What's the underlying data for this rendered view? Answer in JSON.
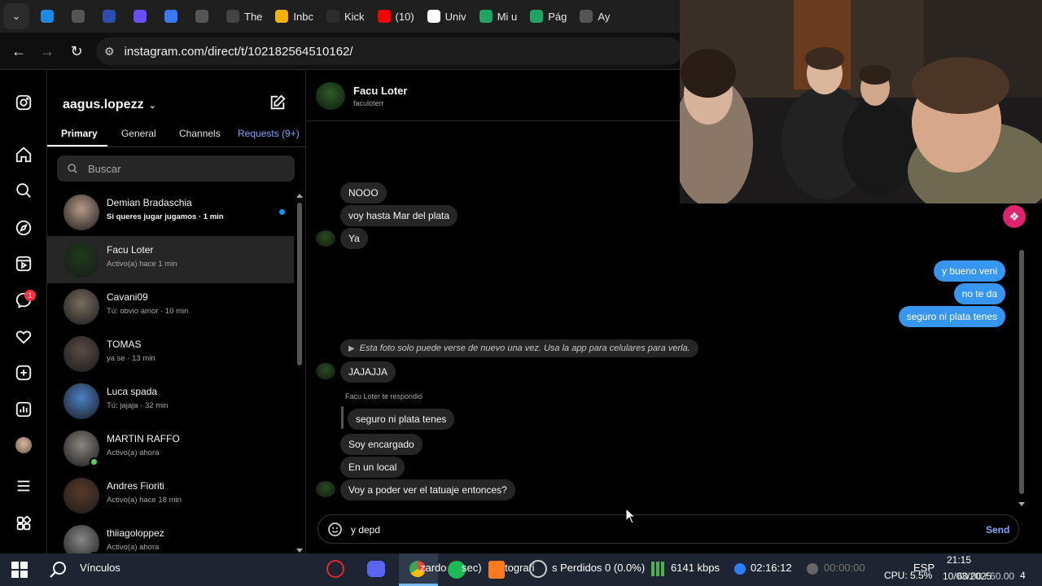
{
  "browser": {
    "tabs": [
      {
        "label": "",
        "icon": "cloud-icon",
        "color": "#1e88e5"
      },
      {
        "label": "",
        "icon": "openai-icon",
        "color": "#555555"
      },
      {
        "label": "",
        "icon": "globe-icon",
        "color": "#2d4cb0"
      },
      {
        "label": "",
        "icon": "s-icon",
        "color": "#6a4cff"
      },
      {
        "label": "",
        "icon": "sparkle-icon",
        "color": "#3a78ff"
      },
      {
        "label": "",
        "icon": "openai-icon",
        "color": "#555555"
      },
      {
        "label": "The",
        "icon": "diamond-icon",
        "color": "#444444"
      },
      {
        "label": "Inbc",
        "icon": "emoji-icon",
        "color": "#f2b200"
      },
      {
        "label": "Kick",
        "icon": "kick-icon",
        "color": "#2c2c2c"
      },
      {
        "label": "(10)",
        "icon": "youtube-icon",
        "color": "#ff0000"
      },
      {
        "label": "Univ",
        "icon": "univ-icon",
        "color": "#ffffff"
      },
      {
        "label": "Mi u",
        "icon": "drive-icon",
        "color": "#1fa463"
      },
      {
        "label": "Pág",
        "icon": "drive-icon",
        "color": "#1fa463"
      },
      {
        "label": "Ay",
        "icon": "openai-icon",
        "color": "#555555"
      }
    ],
    "url": "instagram.com/direct/t/102182564510162/"
  },
  "inbox": {
    "account": "aagus.lopezz",
    "tabs": {
      "primary": "Primary",
      "general": "General",
      "channels": "Channels",
      "requests": "Requests (9+)"
    },
    "search_placeholder": "Buscar",
    "threads": [
      {
        "name": "Demian Bradaschia",
        "sub": "Si queres jugar jugamos · 1 min",
        "unread": true
      },
      {
        "name": "Facu Loter",
        "sub": "Activo(a) hace 1 min",
        "selected": true
      },
      {
        "name": "Cavani09",
        "sub": "Tú: obvio amor · 10 min"
      },
      {
        "name": "TOMAS",
        "sub": "ya se · 13 min"
      },
      {
        "name": "Luca spada",
        "sub": "Tú: jajaja · 32 min"
      },
      {
        "name": "MARTIN RAFFO",
        "sub": "Activo(a) ahora",
        "online": true
      },
      {
        "name": "Andres Fioriti",
        "sub": "Activo(a) hace 18 min"
      },
      {
        "name": "thiiagoloppez",
        "sub": "Activo(a) ahora",
        "online": true
      }
    ]
  },
  "rail": {
    "badge": "1"
  },
  "chat": {
    "name": "Facu Loter",
    "username": "faculoterr",
    "messages_in_top": [
      "NOOO",
      "voy hasta Mar del plata",
      "Ya"
    ],
    "messages_out": [
      "y bueno veni",
      "no te da",
      "seguro ni plata tenes"
    ],
    "system_message": "Esta foto solo puede verse de nuevo una vez. Usa la app para celulares para verla.",
    "msg_jajajja": "JAJAJJA",
    "replied_label": "Facu Loter te respondió",
    "reply_quote": "seguro ni plata tenes",
    "messages_in_bottom": [
      "Soy encargado",
      "En un local",
      "Voy a poder ver el tatuaje entonces?"
    ],
    "composer_text": "y depd",
    "send_label": "Send"
  },
  "taskbar": {
    "search": "Vínculos",
    "items": [
      "zardo",
      "sec)",
      "tografí",
      "s Perdidos 0 (0.0%)",
      "6141 kbps",
      "02:16:12",
      "00:00:00",
      "ESP",
      "CPU: 5.5%",
      "60.00 / 60.00",
      "4"
    ],
    "time": "21:15",
    "date": "10/03/2025"
  },
  "colors": {
    "accent": "#3797f0",
    "link": "#7aa7ff",
    "bg": "#000000",
    "bubble_in": "#262626"
  }
}
